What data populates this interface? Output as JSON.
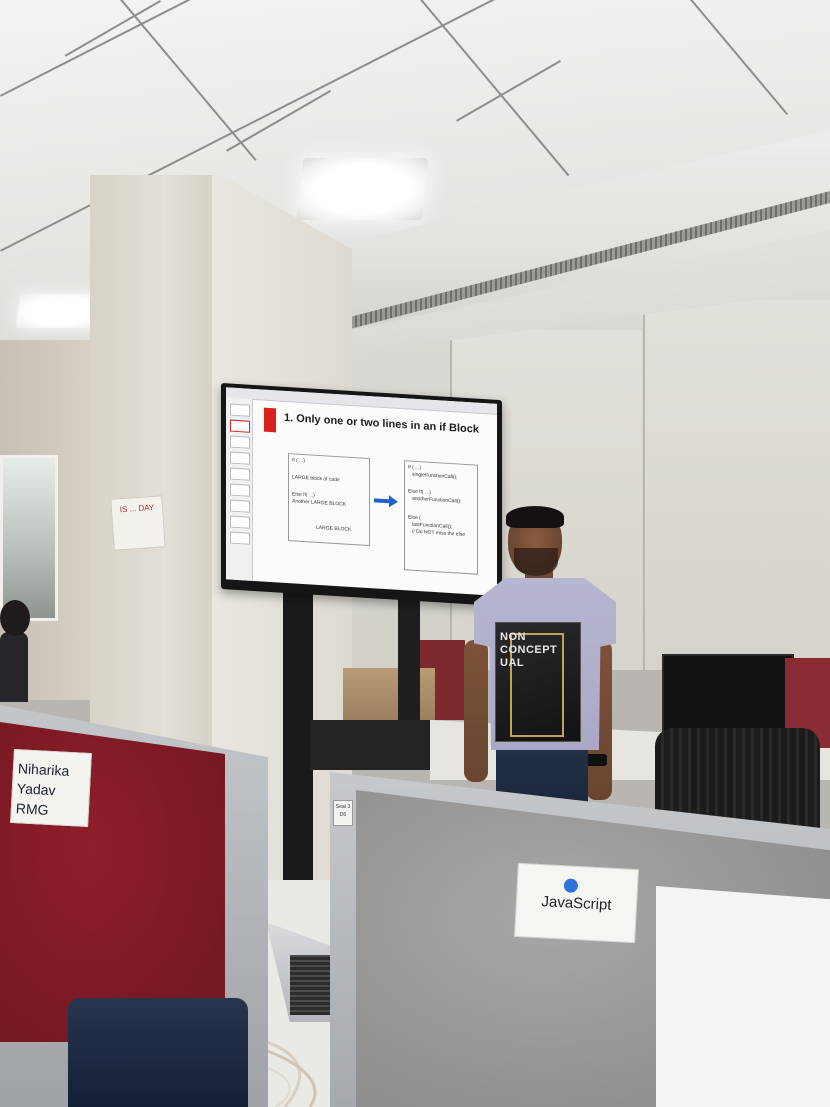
{
  "scene": {
    "colors": {
      "ceiling": "#efefec",
      "partition_red": "#7f1c26",
      "partition_grey": "#9a9999",
      "shirt": "#b0afcb"
    }
  },
  "tv_slide": {
    "title": "1. Only one or two lines in an if Block",
    "left_code": [
      "If ( ...)",
      "LARGE block of code",
      "Else If( ...)",
      "Another LARGE BLOCK",
      "LARGE BLOCK"
    ],
    "right_code": [
      "If ( ...)",
      "singleFunctionCall();",
      "Else If( ...)",
      "anotherFunctionCall();",
      "Else {",
      "lastFunctionCall();",
      "// Do NOT miss the else"
    ]
  },
  "pillar_note": {
    "text": "IS ... DAY"
  },
  "presenter_shirt": {
    "text": "NON CONCEPT UAL"
  },
  "name_card": {
    "line1": "Niharika Yadav",
    "line2": "RMG"
  },
  "seat_label": {
    "text": "Seat 3 D6"
  },
  "js_card": {
    "title": "JavaScript"
  }
}
